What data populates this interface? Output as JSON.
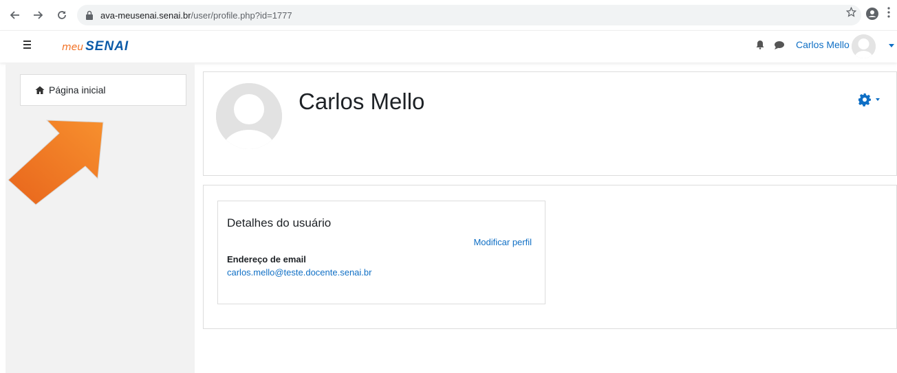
{
  "browser": {
    "url_host": "ava-meusenai.senai.br",
    "url_path": "/user/profile.php?id=1777",
    "back_icon": "arrow-left-icon",
    "forward_icon": "arrow-right-icon",
    "reload_icon": "reload-icon"
  },
  "navbar": {
    "logo_meu": "meu",
    "logo_senai": "SENAI",
    "username": "Carlos Mello"
  },
  "sidebar": {
    "items": [
      {
        "label": "Página inicial",
        "icon": "home-icon"
      }
    ]
  },
  "profile": {
    "name": "Carlos Mello"
  },
  "details": {
    "title": "Detalhes do usuário",
    "edit_link": "Modificar perfil",
    "email_label": "Endereço de email",
    "email_value": "carlos.mello@teste.docente.senai.br"
  },
  "colors": {
    "link": "#0f6fc5",
    "brand_orange": "#f26f21",
    "brand_blue": "#0b5aa8",
    "sidebar_bg": "#f2f2f2"
  }
}
